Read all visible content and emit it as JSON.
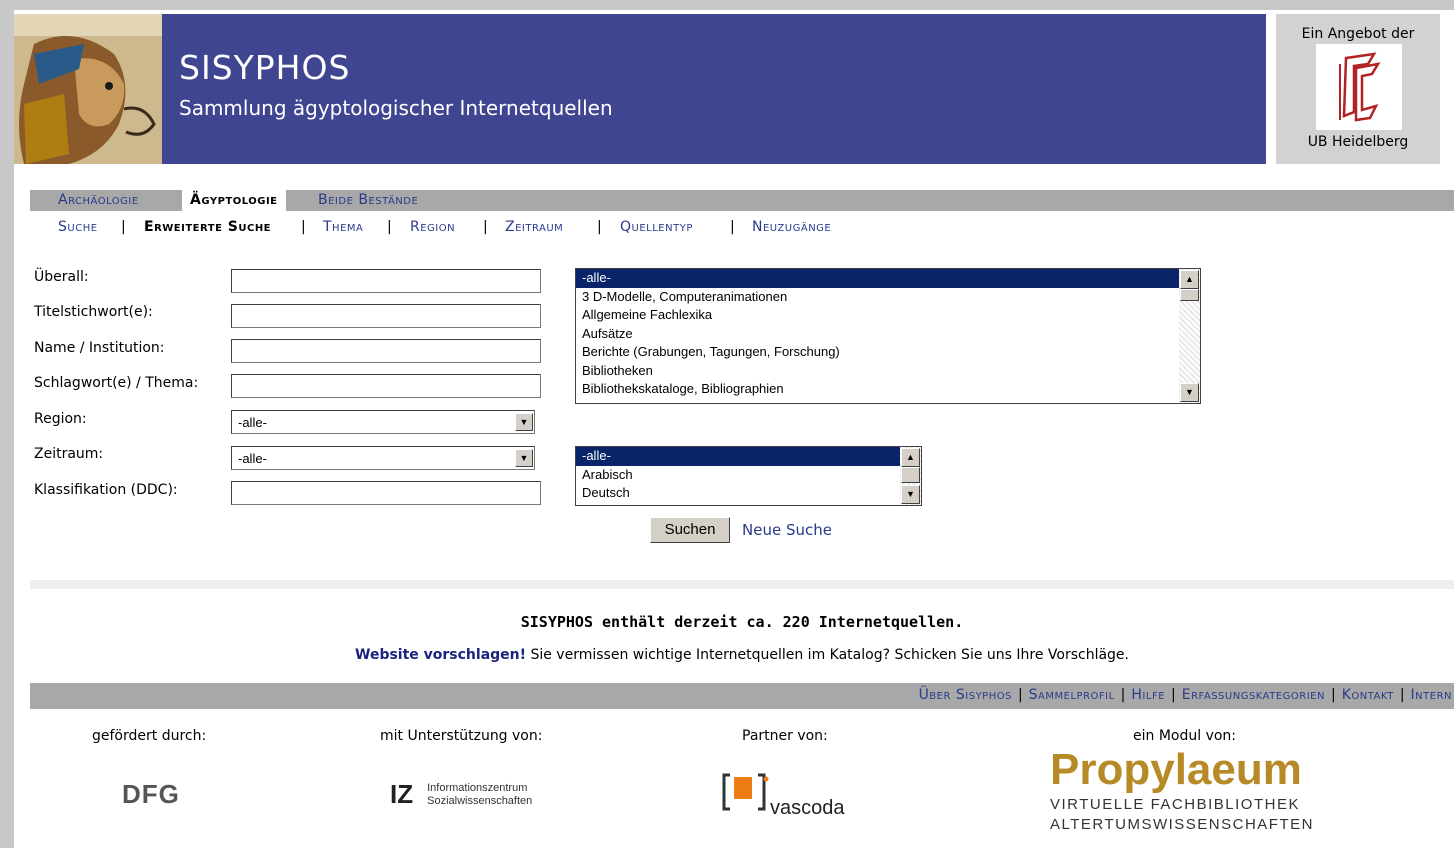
{
  "header": {
    "title": "SISYPHOS",
    "subtitle": "Sammlung ägyptologischer Internetquellen",
    "ub_top": "Ein Angebot der",
    "ub_bottom": "UB Heidelberg"
  },
  "nav_primary": [
    {
      "label": "Archäologie",
      "active": false
    },
    {
      "label": "Ägyptologie",
      "active": true
    },
    {
      "label": "Beide Bestände",
      "active": false
    }
  ],
  "nav_secondary": [
    {
      "label": "Suche",
      "active": false
    },
    {
      "label": "Erweiterte Suche",
      "active": true
    },
    {
      "label": "Thema",
      "active": false
    },
    {
      "label": "Region",
      "active": false
    },
    {
      "label": "Zeitraum",
      "active": false
    },
    {
      "label": "Quellentyp",
      "active": false
    },
    {
      "label": "Neuzugänge",
      "active": false
    }
  ],
  "form": {
    "labels": {
      "ueberall": "Überall:",
      "titel": "Titelstichwort(e):",
      "name": "Name / Institution:",
      "schlagwort": "Schlagwort(e) / Thema:",
      "region": "Region:",
      "zeitraum": "Zeitraum:",
      "klassifikation": "Klassifikation (DDC):"
    },
    "values": {
      "ueberall": "",
      "titel": "",
      "name": "",
      "schlagwort": "",
      "klassifikation": ""
    },
    "region_selected": "-alle-",
    "zeitraum_selected": "-alle-",
    "quellentyp_list": [
      "-alle-",
      "3 D-Modelle, Computeranimationen",
      "Allgemeine Fachlexika",
      "Aufsätze",
      "Berichte (Grabungen, Tagungen, Forschung)",
      "Bibliotheken",
      "Bibliothekskataloge, Bibliographien"
    ],
    "sprache_list": [
      "-alle-",
      "Arabisch",
      "Deutsch"
    ],
    "search_button": "Suchen",
    "new_search_link": "Neue Suche"
  },
  "info": {
    "count_text": "SISYPHOS enthält derzeit ca. 220 Internetquellen.",
    "suggest_link": "Website vorschlagen!",
    "suggest_text": " Sie vermissen wichtige Internetquellen im Katalog? Schicken Sie uns Ihre Vorschläge."
  },
  "footer_nav": [
    "Über Sisyphos",
    "Sammelprofil",
    "Hilfe",
    "Erfassungskategorien",
    "Kontakt",
    "Intern"
  ],
  "sponsors": {
    "label_dfg": "gefördert durch:",
    "label_iz": "mit Unterstützung von:",
    "label_partner": "Partner von:",
    "label_modul": "ein Modul von:",
    "dfg_logo": "DFG",
    "iz_mark": "IZ",
    "iz_line1": "Informationszentrum",
    "iz_line2": "Sozialwissenschaften",
    "vascoda": "vascoda",
    "propy_word": "Propylaeum",
    "propy_line1": "VIRTUELLE FACHBIBLIOTHEK",
    "propy_line2": "ALTERTUMSWISSENSCHAFTEN"
  },
  "colors": {
    "banner": "#3f4590",
    "nav_link": "#2a3a8c",
    "propylaeum_gold": "#b68a26"
  }
}
